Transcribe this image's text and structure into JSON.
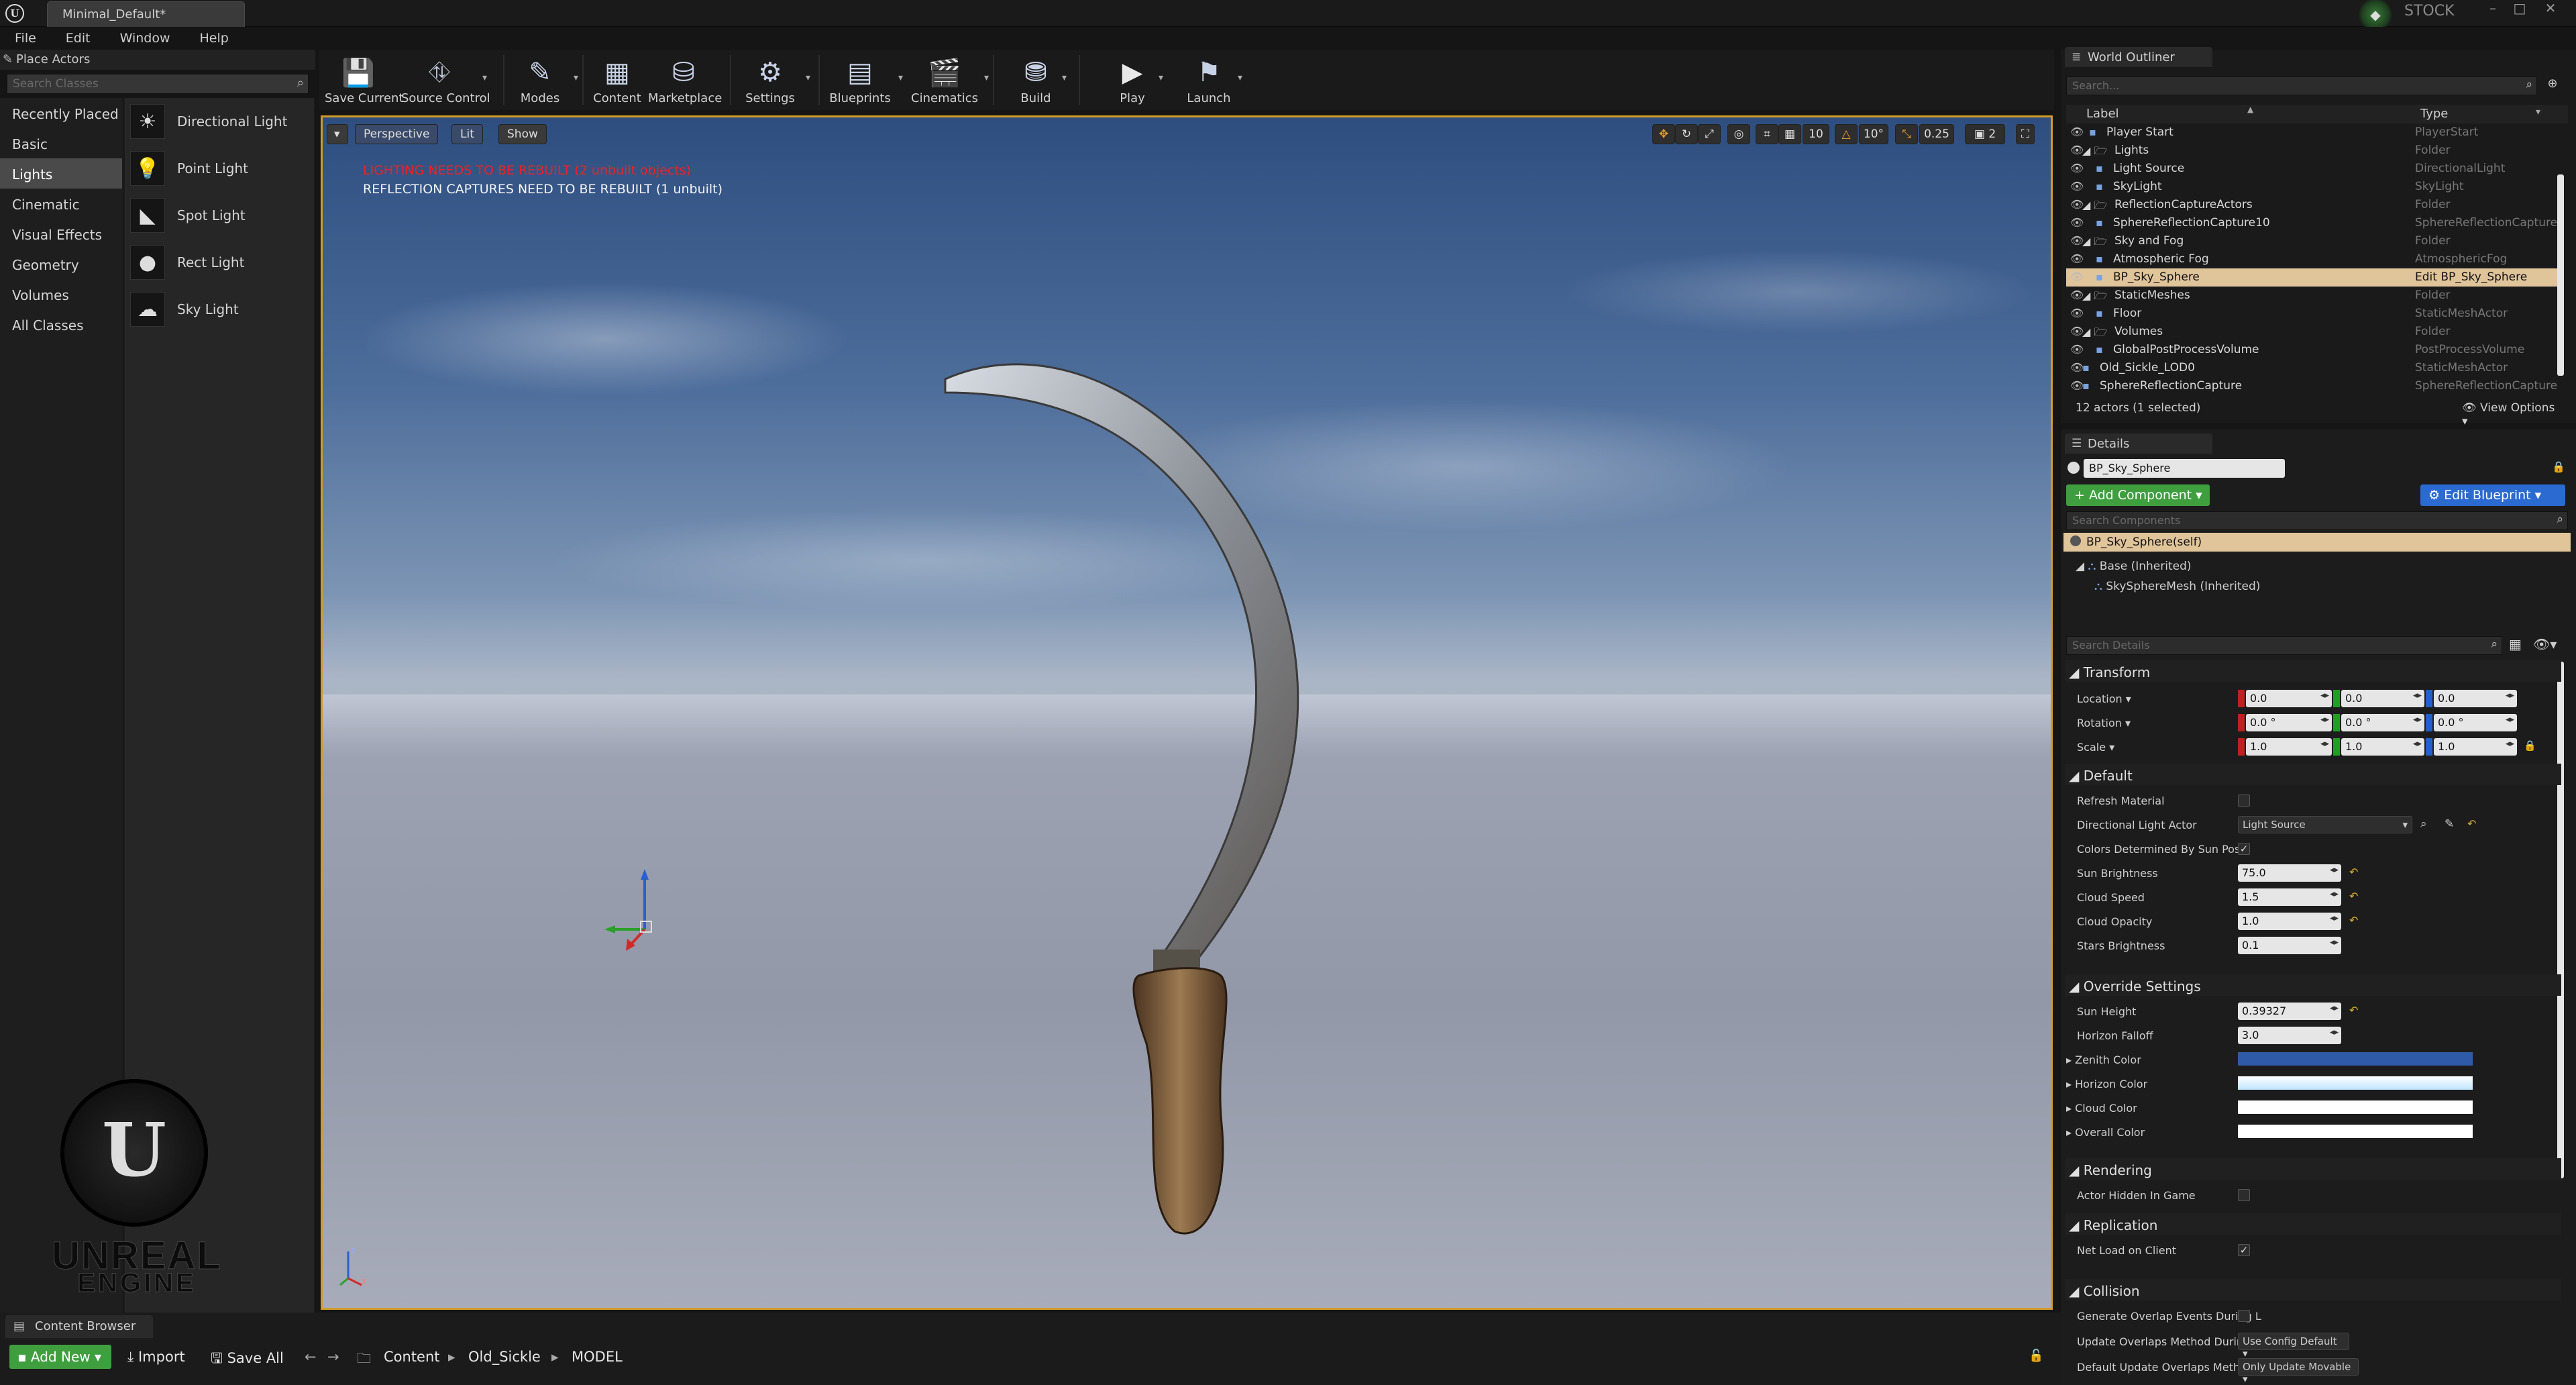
{
  "app": {
    "doc_tab": "Minimal_Default*",
    "stock_label": "STOCK",
    "window_controls": [
      "minimize-icon",
      "maximize-icon",
      "close-icon"
    ]
  },
  "menu": [
    "File",
    "Edit",
    "Window",
    "Help"
  ],
  "place_actors": {
    "title": "Place Actors",
    "search_placeholder": "Search Classes",
    "categories": [
      "Recently Placed",
      "Basic",
      "Lights",
      "Cinematic",
      "Visual Effects",
      "Geometry",
      "Volumes",
      "All Classes"
    ],
    "selected_category": "Lights",
    "actors": [
      "Directional Light",
      "Point Light",
      "Spot Light",
      "Rect Light",
      "Sky Light"
    ]
  },
  "logo": {
    "line1": "UNREAL",
    "line2": "ENGINE"
  },
  "toolbar": {
    "buttons": [
      "Save Current",
      "Source Control",
      "Modes",
      "Content",
      "Marketplace",
      "Settings",
      "Blueprints",
      "Cinematics",
      "Build",
      "Play",
      "Launch"
    ]
  },
  "viewport": {
    "perspective": "Perspective",
    "lit": "Lit",
    "show": "Show",
    "grid_snap": "10",
    "rot_snap": "10°",
    "scale_snap": "0.25",
    "camera_speed": "2",
    "warning_lighting": "LIGHTING NEEDS TO BE REBUILT (2 unbuilt objects)",
    "warning_reflection": "REFLECTION CAPTURES NEED TO BE REBUILT (1 unbuilt)",
    "colors": {
      "selection_border": "#d19b28",
      "warning_red": "#e22222"
    }
  },
  "outliner": {
    "title": "World Outliner",
    "search_placeholder": "Search...",
    "col_label": "Label",
    "col_type": "Type",
    "rows": [
      {
        "label": "Player Start",
        "type": "PlayerStart"
      },
      {
        "label": "Lights",
        "type": "Folder"
      },
      {
        "label": "Light Source",
        "type": "DirectionalLight"
      },
      {
        "label": "SkyLight",
        "type": "SkyLight"
      },
      {
        "label": "ReflectionCaptureActors",
        "type": "Folder"
      },
      {
        "label": "SphereReflectionCapture10",
        "type": "SphereReflectionCapture"
      },
      {
        "label": "Sky and Fog",
        "type": "Folder"
      },
      {
        "label": "Atmospheric Fog",
        "type": "AtmosphericFog"
      },
      {
        "label": "BP_Sky_Sphere",
        "type": "Edit BP_Sky_Sphere"
      },
      {
        "label": "StaticMeshes",
        "type": "Folder"
      },
      {
        "label": "Floor",
        "type": "StaticMeshActor"
      },
      {
        "label": "Volumes",
        "type": "Folder"
      },
      {
        "label": "GlobalPostProcessVolume",
        "type": "PostProcessVolume"
      },
      {
        "label": "Old_Sickle_LOD0",
        "type": "StaticMeshActor"
      },
      {
        "label": "SphereReflectionCapture",
        "type": "SphereReflectionCapture"
      }
    ],
    "selected_row": "BP_Sky_Sphere",
    "actor_count": "12 actors (1 selected)",
    "view_options": "View Options"
  },
  "details": {
    "title": "Details",
    "actor_name": "BP_Sky_Sphere",
    "add_component": "+ Add Component",
    "edit_blueprint": "Edit Blueprint",
    "search_components": "Search Components",
    "self_component": "BP_Sky_Sphere(self)",
    "base_inherited": "Base (Inherited)",
    "mesh_inherited": "SkySphereMesh (Inherited)",
    "search_details": "Search Details",
    "transform": {
      "title": "Transform",
      "location_label": "Location",
      "rotation_label": "Rotation",
      "scale_label": "Scale",
      "location": [
        "0.0",
        "0.0",
        "0.0"
      ],
      "rotation": [
        "0.0 °",
        "0.0 °",
        "0.0 °"
      ],
      "scale": [
        "1.0",
        "1.0",
        "1.0"
      ]
    },
    "default": {
      "title": "Default",
      "refresh_material": "Refresh Material",
      "directional_light_actor": "Directional Light Actor",
      "directional_light_value": "Light Source",
      "colors_determined": "Colors Determined By Sun Positi",
      "sun_brightness_label": "Sun Brightness",
      "sun_brightness": "75.0",
      "cloud_speed_label": "Cloud Speed",
      "cloud_speed": "1.5",
      "cloud_opacity_label": "Cloud Opacity",
      "cloud_opacity": "1.0",
      "stars_brightness_label": "Stars Brightness",
      "stars_brightness": "0.1"
    },
    "override": {
      "title": "Override Settings",
      "sun_height_label": "Sun Height",
      "sun_height": "0.39327",
      "horizon_falloff_label": "Horizon Falloff",
      "horizon_falloff": "3.0",
      "zenith_color_label": "Zenith Color",
      "horizon_color_label": "Horizon Color",
      "cloud_color_label": "Cloud Color",
      "overall_color_label": "Overall Color",
      "colors": {
        "zenith": "#2f5aa8",
        "horizon": "#bfe6ff",
        "cloud": "#ffffff",
        "overall": "#ffffff"
      }
    },
    "rendering": {
      "title": "Rendering",
      "actor_hidden": "Actor Hidden In Game"
    },
    "replication": {
      "title": "Replication",
      "net_load": "Net Load on Client"
    },
    "collision": {
      "title": "Collision",
      "gen_overlap": "Generate Overlap Events During L",
      "update_overlaps": "Update Overlaps Method During",
      "update_overlaps_value": "Use Config Default",
      "default_update": "Default Update Overlaps Method",
      "default_update_value": "Only Update Movable"
    }
  },
  "content_browser": {
    "title": "Content Browser",
    "add_new": "Add New",
    "import": "Import",
    "save_all": "Save All",
    "path": [
      "Content",
      "Old_Sickle",
      "MODEL"
    ]
  }
}
